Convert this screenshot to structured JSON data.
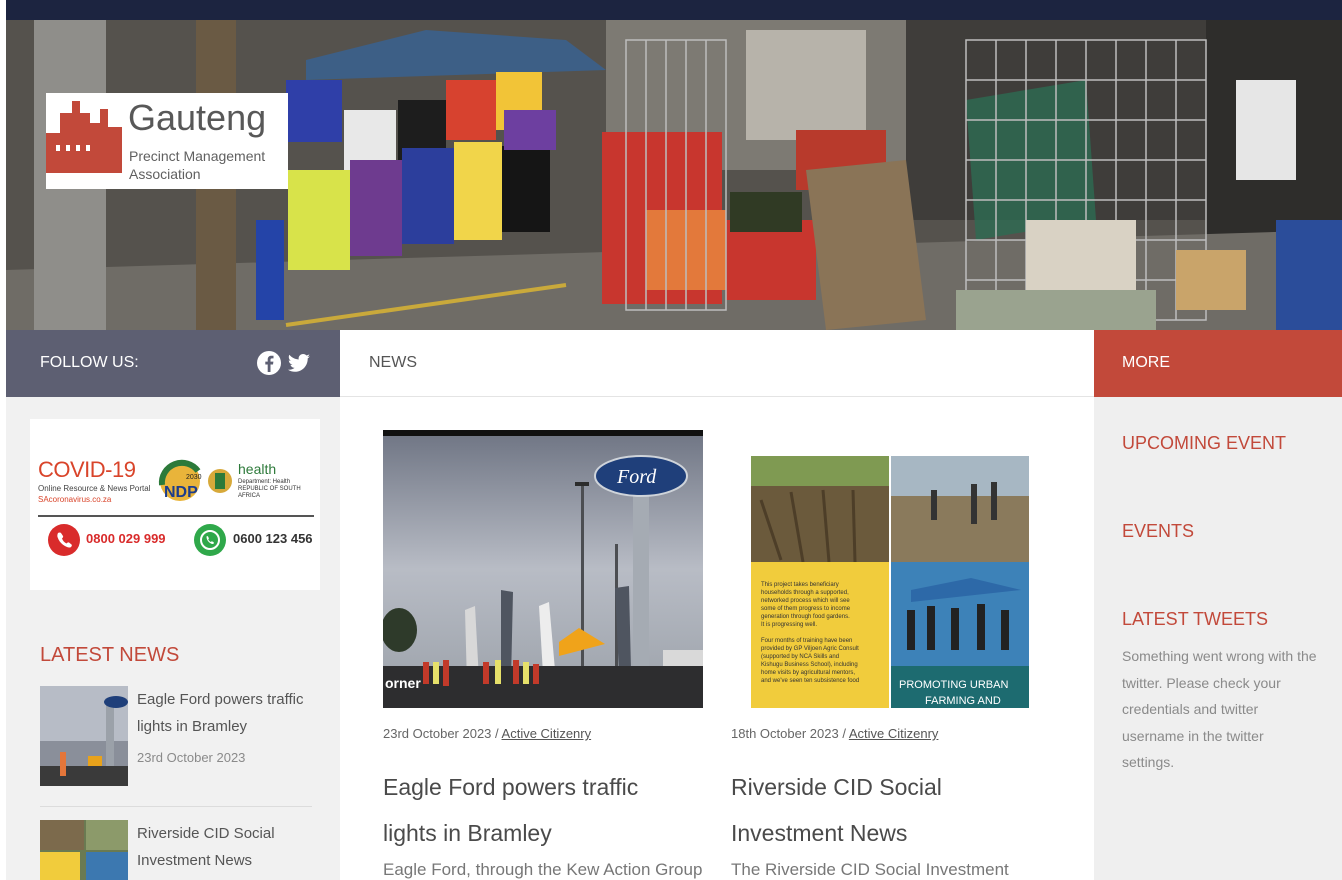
{
  "branding": {
    "title": "Gauteng",
    "subtitle_line1": "Precinct Management",
    "subtitle_line2": "Association"
  },
  "sidebar_left": {
    "follow_label": "FOLLOW US:",
    "social_icons": [
      "facebook-icon",
      "twitter-icon"
    ],
    "covid_banner": {
      "title": "COVID-19",
      "portal_line": "Online Resource & News Portal",
      "site": "SAcoronavirus.co.za",
      "ndp": "NDP",
      "ndp_year": "2030",
      "health": "health",
      "health_sub": "Department: Health REPUBLIC OF SOUTH AFRICA",
      "hotline": "0800 029 999",
      "whatsapp": "0600 123 456"
    },
    "latest_news_heading": "LATEST NEWS",
    "latest_news": [
      {
        "title": "Eagle Ford powers traffic lights in Bramley",
        "date": "23rd October 2023"
      },
      {
        "title": "Riverside CID Social Investment News",
        "date": ""
      }
    ]
  },
  "main": {
    "section_label": "NEWS",
    "posts": [
      {
        "date": "23rd October 2023",
        "separator": " / ",
        "category": "Active Citizenry",
        "title": "Eagle Ford powers traffic lights in Bramley",
        "excerpt": "Eagle Ford, through the Kew Action Group,",
        "image_text": "orner"
      },
      {
        "date": "18th October 2023",
        "separator": " / ",
        "category": "Active Citizenry",
        "title": "Riverside CID Social Investment News",
        "excerpt": "The Riverside CID Social Investment",
        "image_caption": "PROMOTING URBAN FARMING AND",
        "image_body": "This project takes beneficiary households through a supported, networked process which will see some of them progress to income generation through food gardens. It is progressing well.",
        "image_body2": "Four months of training have been provided by GP Viljoen Agric Consult (supported by NCA Skills and Kishugu Business School), including home visits by agricultural mentors, and we've seen ten subsistence food"
      }
    ]
  },
  "sidebar_right": {
    "more_label": "MORE",
    "upcoming_event": "UPCOMING EVENT",
    "events": "EVENTS",
    "latest_tweets": "LATEST TWEETS",
    "tweet_error": "Something went wrong with the twitter. Please check your credentials and twitter username in the twitter settings."
  },
  "colors": {
    "accent": "#c2493a",
    "follow_bar": "#5d5f72",
    "top_bar": "#1c2440"
  }
}
